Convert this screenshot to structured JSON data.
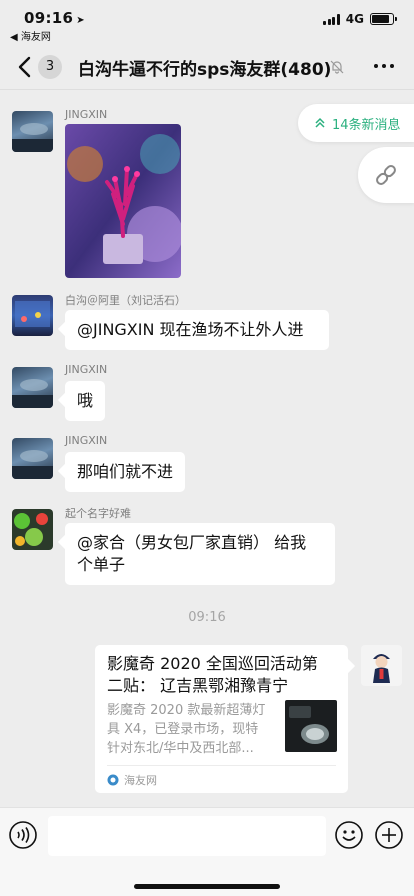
{
  "status_bar": {
    "time": "09:16",
    "back_app": "◀ 海友网",
    "network": "4G"
  },
  "nav": {
    "back_count": "3",
    "title": "白沟牛逼不行的sps海友群(480)"
  },
  "floating": {
    "new_messages": "14条新消息"
  },
  "messages": [
    {
      "sender": "JINGXIN",
      "type": "image"
    },
    {
      "sender": "白沟＠阿里（刘记活石）",
      "text": "@JINGXIN 现在渔场不让外人进"
    },
    {
      "sender": "JINGXIN",
      "text": "哦"
    },
    {
      "sender": "JINGXIN",
      "text": "那咱们就不进"
    },
    {
      "sender": "起个名字好难",
      "text_line1": "@家合（男女包厂家直销） 给我",
      "text_line2": "个单子"
    }
  ],
  "timestamp": "09:16",
  "link_card": {
    "title_line1": "影魔奇 2020 全国巡回活动第",
    "title_line2": "二贴： 辽吉黑鄂湘豫青宁",
    "desc_line1": "影魔奇 2020 款最新超薄灯",
    "desc_line2": "具 X4，已登录市场，现特",
    "desc_line3": "针对东北/华中及西北部...",
    "source": "海友网"
  },
  "colors": {
    "accent_green": "#2bb07f",
    "chat_bg": "#ededed"
  }
}
